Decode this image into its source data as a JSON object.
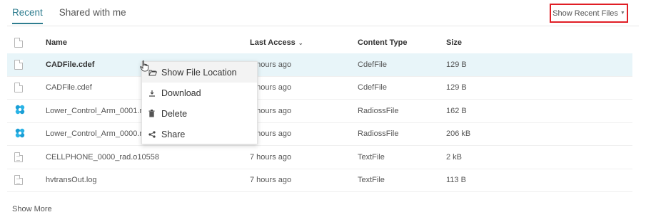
{
  "tabs": [
    {
      "label": "Recent",
      "active": true
    },
    {
      "label": "Shared with me",
      "active": false
    }
  ],
  "filter": {
    "label": "Show Recent Files"
  },
  "table": {
    "headers": {
      "name": "Name",
      "access": "Last Access",
      "type": "Content Type",
      "size": "Size"
    },
    "rows": [
      {
        "name": "CADFile.cdef",
        "access": "7 hours ago",
        "type": "CdefFile",
        "size": "129 B",
        "icon": "file-icon"
      },
      {
        "name": "CADFile.cdef",
        "access": "7 hours ago",
        "type": "CdefFile",
        "size": "129 B",
        "icon": "file-icon"
      },
      {
        "name": "Lower_Control_Arm_0001.rad",
        "access": "7 hours ago",
        "type": "RadiossFile",
        "size": "162 B",
        "icon": "radioss-icon"
      },
      {
        "name": "Lower_Control_Arm_0000.rad",
        "access": "7 hours ago",
        "type": "RadiossFile",
        "size": "206 kB",
        "icon": "radioss-icon"
      },
      {
        "name": "CELLPHONE_0000_rad.o10558",
        "access": "7 hours ago",
        "type": "TextFile",
        "size": "2 kB",
        "icon": "text-file-icon"
      },
      {
        "name": "hvtransOut.log",
        "access": "7 hours ago",
        "type": "TextFile",
        "size": "113 B",
        "icon": "text-file-icon"
      }
    ]
  },
  "context_menu": {
    "items": [
      {
        "label": "Show File Location",
        "icon": "folder-open-icon"
      },
      {
        "label": "Download",
        "icon": "download-icon"
      },
      {
        "label": "Delete",
        "icon": "trash-icon"
      },
      {
        "label": "Share",
        "icon": "share-icon"
      }
    ]
  },
  "footer": {
    "show_more": "Show More"
  },
  "colors": {
    "accent": "#2e7d8f",
    "highlight_border": "#e01e25",
    "selected_row": "#e8f5f9"
  }
}
